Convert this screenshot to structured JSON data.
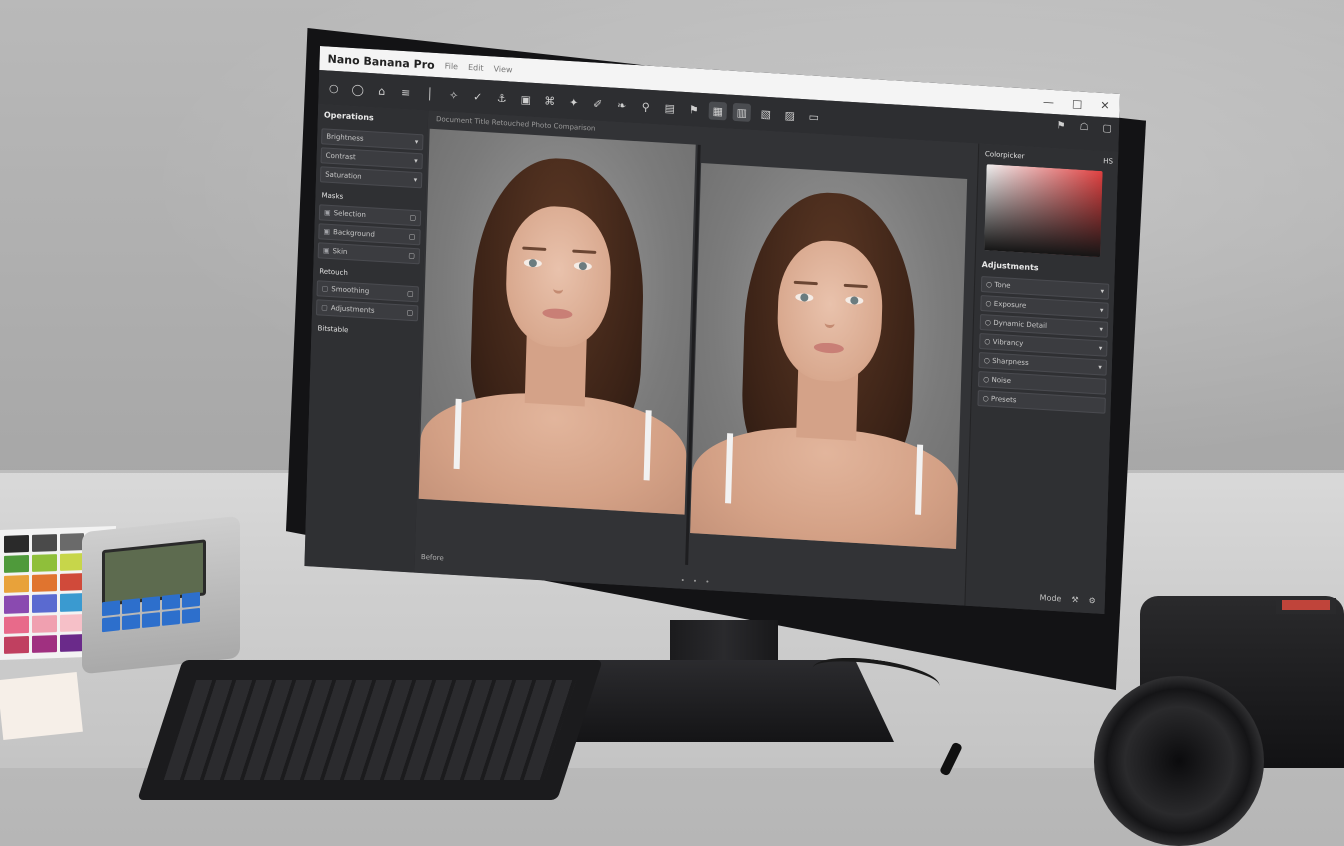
{
  "app": {
    "title": "Nano Banana Pro",
    "menu": [
      "File",
      "Edit",
      "View"
    ]
  },
  "window_controls": [
    "—",
    "□",
    "✕"
  ],
  "toolbar": {
    "tools": [
      "○",
      "◯",
      "⌂",
      "≡",
      "│",
      "✧",
      "✓",
      "⚓",
      "▣",
      "⌘",
      "✦",
      "✐",
      "❧",
      "⚲",
      "▤",
      "⚑",
      "▦",
      "▥",
      "▧",
      "▨",
      "▭"
    ]
  },
  "left_panel": {
    "title": "Operations",
    "rows": [
      {
        "label": "Brightness",
        "icon": "◆",
        "trail": "▾"
      },
      {
        "label": "Contrast",
        "icon": "◆",
        "trail": "▾"
      },
      {
        "label": "Saturation",
        "icon": "◆",
        "trail": "▾"
      }
    ],
    "section": "Masks",
    "mask_rows": [
      {
        "label": "Selection",
        "icon": "▣",
        "trail": "▢"
      },
      {
        "label": "Background",
        "icon": "▣",
        "trail": "▢"
      },
      {
        "label": "Skin",
        "icon": "▣",
        "trail": "▢"
      }
    ],
    "section2": "Retouch",
    "retouch_rows": [
      {
        "label": "Smoothing",
        "icon": "▢",
        "trail": "▢"
      },
      {
        "label": "Adjustments",
        "icon": "▢",
        "trail": "▢"
      }
    ],
    "footer": "Bitstable"
  },
  "canvas": {
    "path": "Document Title Retouched Photo Comparison",
    "bottom_label": "Before",
    "pagination": "• • •"
  },
  "right_panel": {
    "icons": [
      "⚑",
      "☖",
      "▢"
    ],
    "color_head": "Colorpicker",
    "color_head_right": "HS",
    "colors": {
      "picker_hot": "#e04040",
      "picker_light": "#f0f0f0",
      "picker_dark": "#151515"
    },
    "adjust_head": "Adjustments",
    "rows": [
      {
        "label": "Tone",
        "icon": "○",
        "trail": "▾"
      },
      {
        "label": "Exposure",
        "icon": "○",
        "trail": "▾"
      },
      {
        "label": "Dynamic Detail",
        "icon": "○",
        "trail": "▾"
      },
      {
        "label": "Vibrancy",
        "icon": "○",
        "trail": "▾"
      },
      {
        "label": "Sharpness",
        "icon": "○",
        "trail": "▾"
      },
      {
        "label": "Noise",
        "icon": "○",
        "trail": ""
      },
      {
        "label": "Presets",
        "icon": "○",
        "trail": ""
      }
    ],
    "status": [
      "Mode",
      "⚒",
      "⚙"
    ]
  },
  "color_chart": {
    "swatches": [
      "#2a2a2a",
      "#4a4a4a",
      "#6a6a6a",
      "#8a8a8a",
      "#4f9a3b",
      "#8fbf3a",
      "#c7d64a",
      "#e8e04a",
      "#e8a23a",
      "#e0742f",
      "#d04a3a",
      "#c0306a",
      "#8a4ab0",
      "#5a6ad0",
      "#3a9ad0",
      "#3ac0b0",
      "#e86a8a",
      "#f0a0b0",
      "#f6c0c8",
      "#ffffff",
      "#c04060",
      "#a03080",
      "#6a2a8a",
      "#40205a"
    ]
  }
}
